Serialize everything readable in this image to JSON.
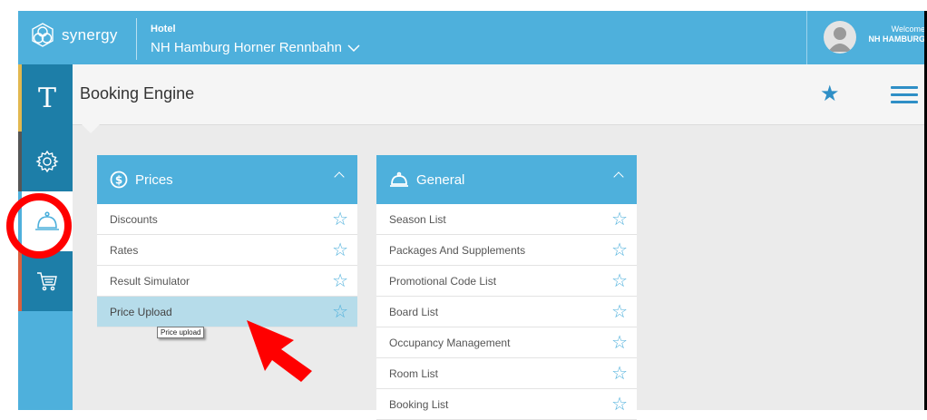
{
  "topbar": {
    "logo": "synergy",
    "hotel_label": "Hotel",
    "hotel_name": "NH Hamburg Horner Rennbahn",
    "welcome_label": "Welcome",
    "user_name": "NH HAMBURG"
  },
  "sidebar": {
    "items": [
      {
        "icon": "t-letter-icon",
        "label": "T"
      },
      {
        "icon": "gear-icon"
      },
      {
        "icon": "bell-icon",
        "active": true
      },
      {
        "icon": "cart-icon"
      }
    ]
  },
  "header": {
    "title": "Booking Engine"
  },
  "panels": [
    {
      "title": "Prices",
      "icon": "dollar-icon",
      "items": [
        "Discounts",
        "Rates",
        "Result Simulator",
        "Price Upload"
      ],
      "highlighted": "Price Upload"
    },
    {
      "title": "General",
      "icon": "bell-icon",
      "items": [
        "Season List",
        "Packages And Supplements",
        "Promotional Code List",
        "Board List",
        "Occupancy Management",
        "Room List",
        "Booking List"
      ]
    }
  ],
  "tooltip": "Price upload",
  "colors": {
    "primary": "#4eb0dc",
    "dark": "#1d7ea8",
    "accent": "#2f8fc6",
    "highlight": "#b6dcea",
    "annotation": "#ff0000"
  }
}
